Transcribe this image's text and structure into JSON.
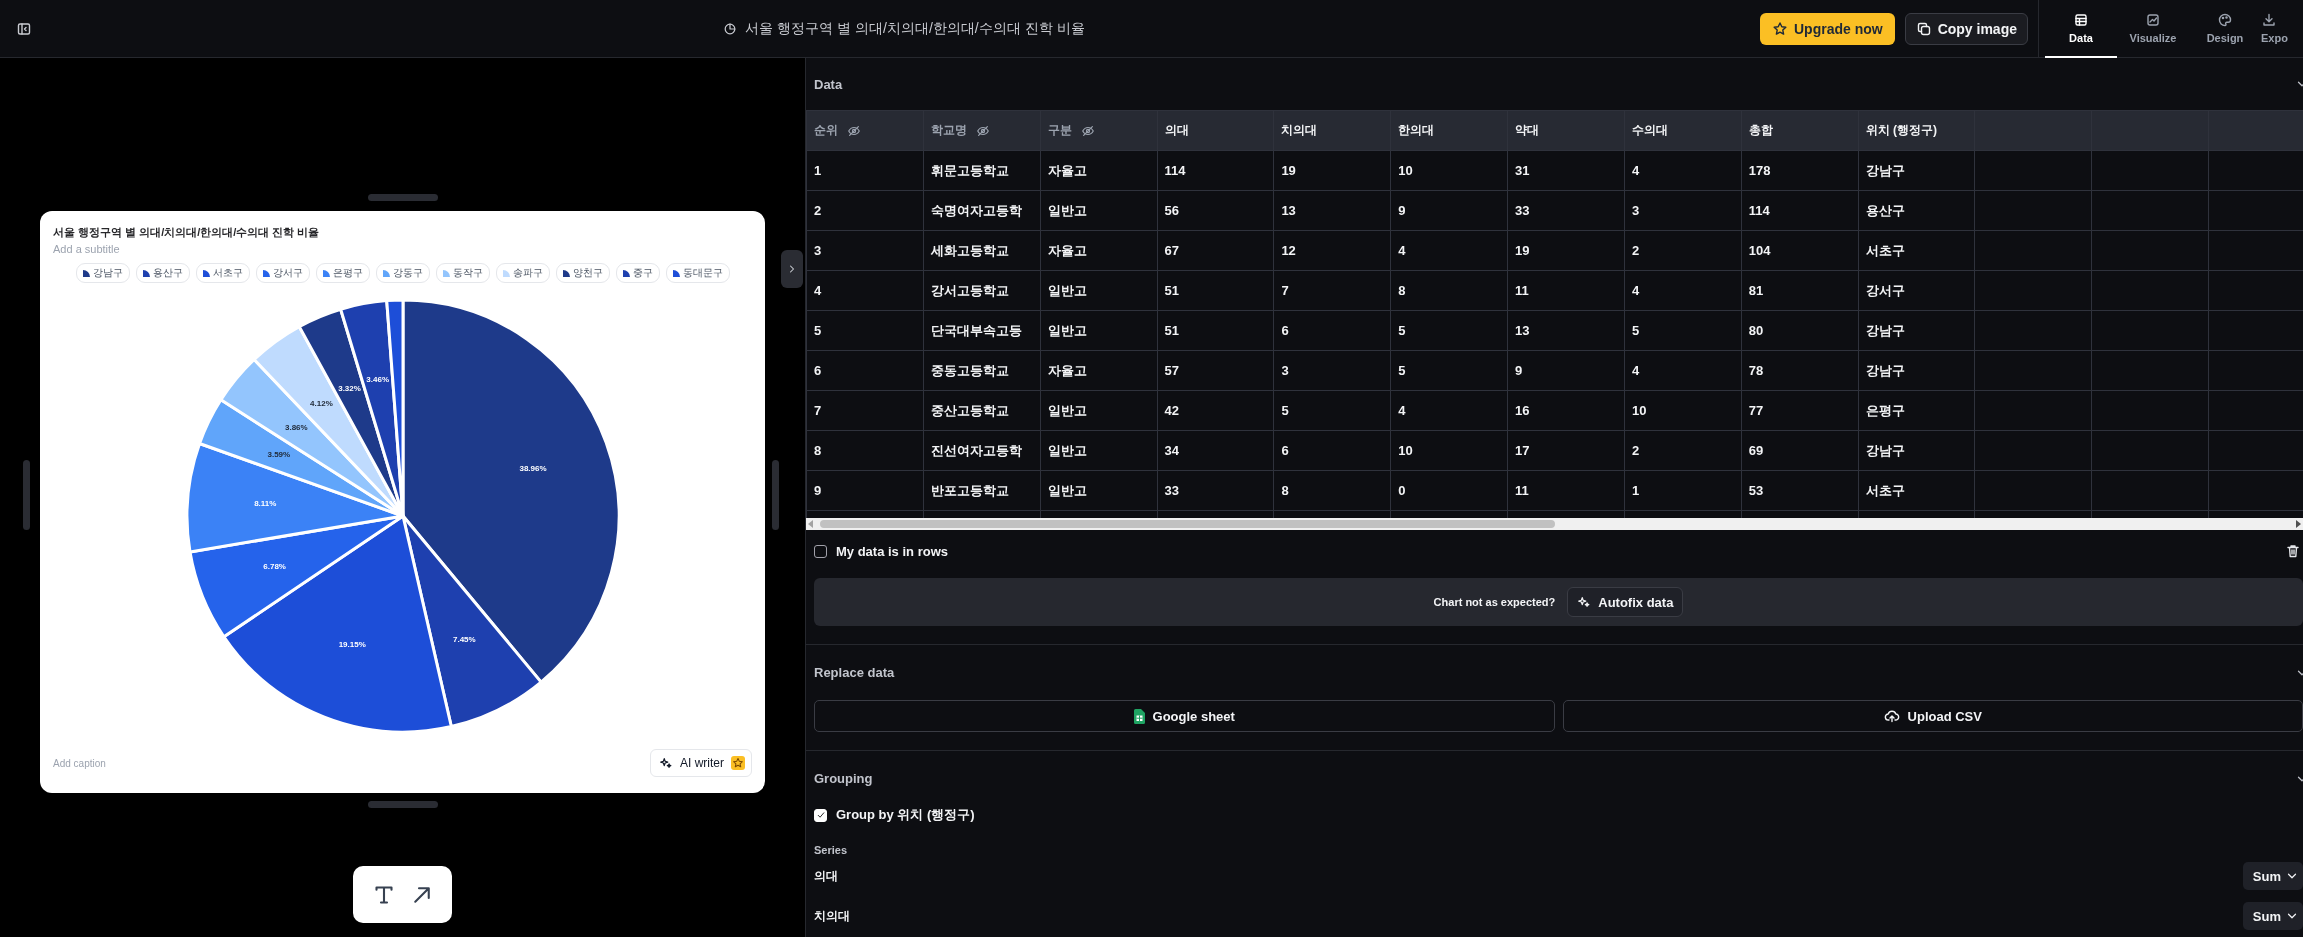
{
  "toolbar": {
    "title": "서울 행정구역 별 의대/치의대/한의대/수의대 진학 비율",
    "upgrade_button": "Upgrade now",
    "copy_button": "Copy image",
    "tabs": [
      {
        "label": "Data",
        "kind": "table",
        "selected": true
      },
      {
        "label": "Visualize",
        "kind": "chart",
        "selected": false
      },
      {
        "label": "Design",
        "kind": "palette",
        "selected": false
      },
      {
        "label": "Expo",
        "kind": "export",
        "selected": false
      }
    ]
  },
  "chart_card": {
    "title": "서울 행정구역 별 의대/치의대/한의대/수의대 진학 비율",
    "subtitle_placeholder": "Add a subtitle",
    "caption_placeholder": "Add caption",
    "ai_button": "AI writer",
    "chart_data": {
      "type": "pie",
      "categories": [
        "강남구",
        "용산구",
        "서초구",
        "강서구",
        "은평구",
        "강동구",
        "동작구",
        "송파구",
        "양천구",
        "중구",
        "동대문구"
      ],
      "series": [
        {
          "colors": [
            "#1e3a8a",
            "#1e40af",
            "#1d4ed8",
            "#2563eb",
            "#3b82f6",
            "#60a5fa",
            "#93c5fd",
            "#bfdbfe",
            "#1e3a8a",
            "#1e40af",
            "#1d4ed8"
          ],
          "values": [
            38.96,
            7.45,
            19.15,
            6.78,
            8.11,
            3.59,
            3.86,
            4.12,
            3.32,
            3.46,
            1.2
          ]
        }
      ],
      "value_labels": [
        "38.96%",
        "7.45%",
        "19.15%",
        "6.78%",
        "8.11%",
        "3.59%",
        "3.86%",
        "4.12%",
        "3.32%",
        "3.46%",
        null
      ]
    }
  },
  "data_panel": {
    "title": "Data",
    "columns": [
      {
        "label": "순위",
        "hidden": true
      },
      {
        "label": "학교명",
        "hidden": true
      },
      {
        "label": "구분",
        "hidden": true
      },
      {
        "label": "의대",
        "hidden": false
      },
      {
        "label": "치의대",
        "hidden": false
      },
      {
        "label": "한의대",
        "hidden": false
      },
      {
        "label": "약대",
        "hidden": false
      },
      {
        "label": "수의대",
        "hidden": false
      },
      {
        "label": "총합",
        "hidden": false
      },
      {
        "label": "위치 (행정구)",
        "hidden": false
      }
    ],
    "rows": [
      [
        "1",
        "휘문고등학교",
        "자율고",
        "114",
        "19",
        "10",
        "31",
        "4",
        "178",
        "강남구"
      ],
      [
        "2",
        "숙명여자고등학",
        "일반고",
        "56",
        "13",
        "9",
        "33",
        "3",
        "114",
        "용산구"
      ],
      [
        "3",
        "세화고등학교",
        "자율고",
        "67",
        "12",
        "4",
        "19",
        "2",
        "104",
        "서초구"
      ],
      [
        "4",
        "강서고등학교",
        "일반고",
        "51",
        "7",
        "8",
        "11",
        "4",
        "81",
        "강서구"
      ],
      [
        "5",
        "단국대부속고등",
        "일반고",
        "51",
        "6",
        "5",
        "13",
        "5",
        "80",
        "강남구"
      ],
      [
        "6",
        "중동고등학교",
        "자율고",
        "57",
        "3",
        "5",
        "9",
        "4",
        "78",
        "강남구"
      ],
      [
        "7",
        "중산고등학교",
        "일반고",
        "42",
        "5",
        "4",
        "16",
        "10",
        "77",
        "은평구"
      ],
      [
        "8",
        "진선여자고등학",
        "일반고",
        "34",
        "6",
        "10",
        "17",
        "2",
        "69",
        "강남구"
      ],
      [
        "9",
        "반포고등학교",
        "일반고",
        "33",
        "8",
        "0",
        "11",
        "1",
        "53",
        "서초구"
      ]
    ],
    "rows_checkbox": {
      "label": "My data is in rows",
      "checked": false
    },
    "autofix_prompt": "Chart not as expected?",
    "autofix_button": "Autofix data"
  },
  "replace_panel": {
    "title": "Replace data",
    "buttons": [
      {
        "label": "Google sheet",
        "kind": "sheet"
      },
      {
        "label": "Upload CSV",
        "kind": "upload"
      }
    ]
  },
  "grouping_panel": {
    "title": "Grouping",
    "group_checkbox": {
      "label": "Group by 위치 (행정구)",
      "checked": true
    },
    "series_label": "Series",
    "series": [
      {
        "name": "의대",
        "aggregate": "Sum"
      },
      {
        "name": "치의대",
        "aggregate": "Sum"
      }
    ]
  }
}
